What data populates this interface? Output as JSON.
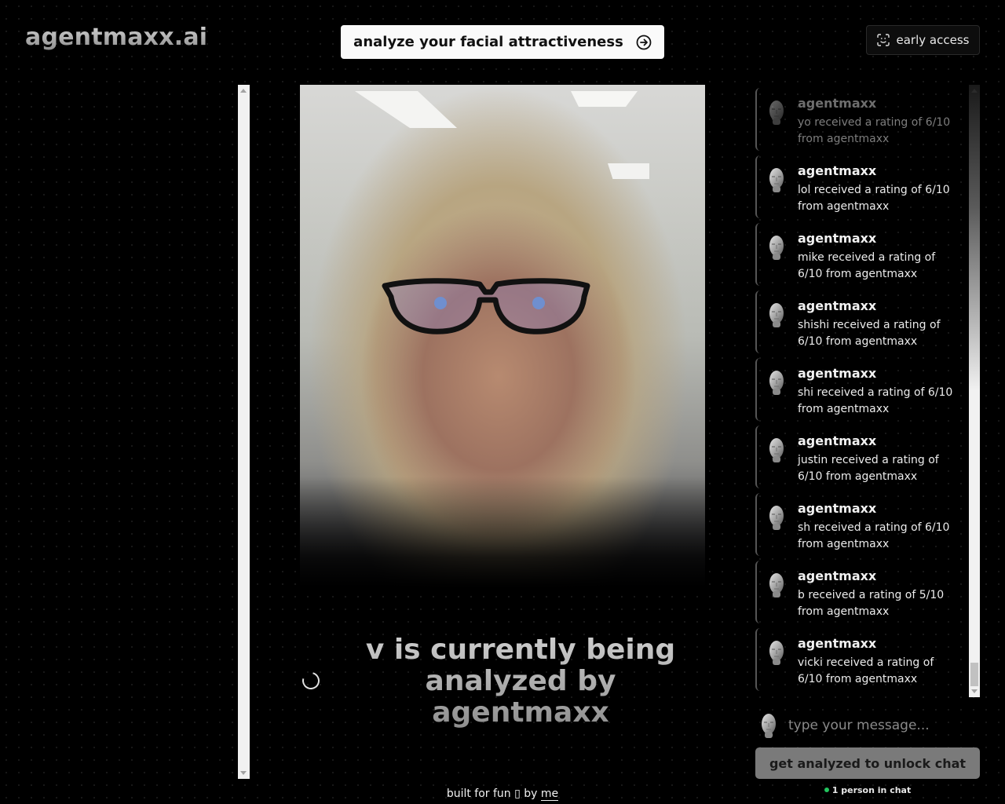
{
  "header": {
    "logo": "agentmaxx.ai",
    "cta_label": "analyze your facial attractiveness",
    "cta_icon": "arrow-right-circle-icon",
    "early_access_label": "early access",
    "early_access_icon": "face-scan-icon"
  },
  "main": {
    "photo_alt": "selfie of person being analyzed",
    "status_text": "v is currently being analyzed by agentmaxx",
    "spinner": "loading-spinner"
  },
  "chat": {
    "messages": [
      {
        "author": "agentmaxx",
        "text": "yo received a rating of 6/10 from agentmaxx"
      },
      {
        "author": "agentmaxx",
        "text": "lol received a rating of 6/10 from agentmaxx"
      },
      {
        "author": "agentmaxx",
        "text": "mike received a rating of 6/10 from agentmaxx"
      },
      {
        "author": "agentmaxx",
        "text": "shishi received a rating of 6/10 from agentmaxx"
      },
      {
        "author": "agentmaxx",
        "text": "shi received a rating of 6/10 from agentmaxx"
      },
      {
        "author": "agentmaxx",
        "text": "justin received a rating of 6/10 from agentmaxx"
      },
      {
        "author": "agentmaxx",
        "text": "sh received a rating of 6/10 from agentmaxx"
      },
      {
        "author": "agentmaxx",
        "text": "b received a rating of 5/10 from agentmaxx"
      },
      {
        "author": "agentmaxx",
        "text": "vicki received a rating of 6/10 from agentmaxx"
      }
    ],
    "input_placeholder": "type your message...",
    "unlock_label": "get analyzed to unlock chat",
    "online_text": "1 person in chat",
    "online_color": "#22c55e"
  },
  "footer": {
    "text": "built for fun ▯ by",
    "link": "me"
  }
}
